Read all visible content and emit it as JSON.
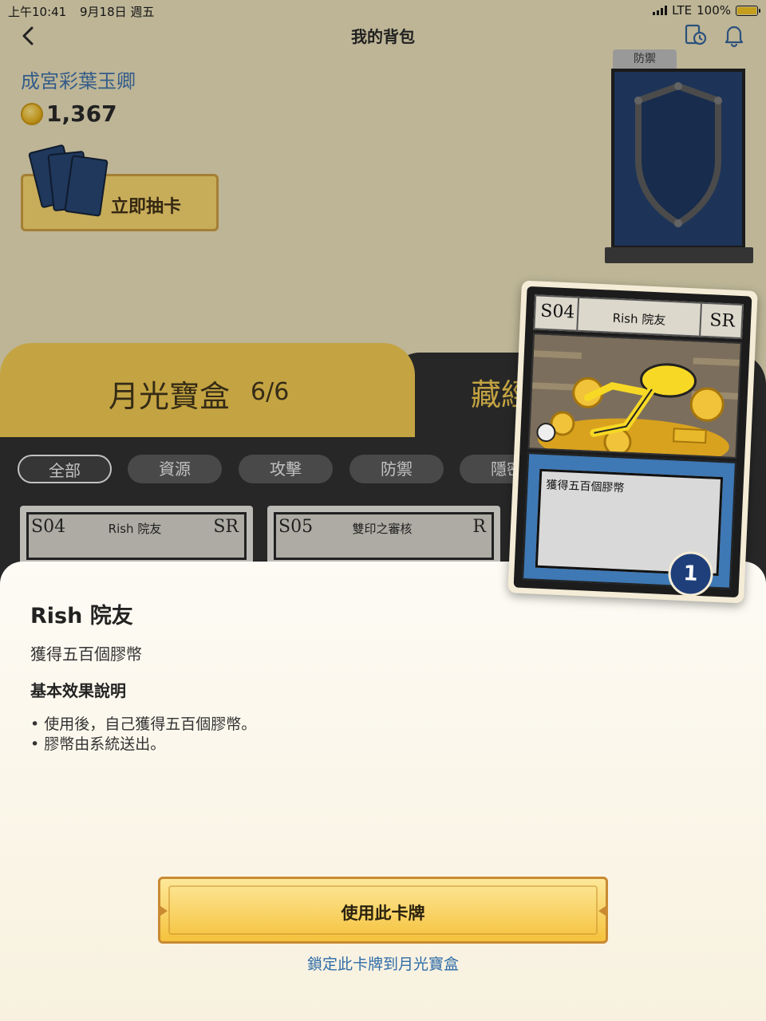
{
  "status_bar": {
    "time": "上午10:41",
    "date": "9月18日 週五",
    "network": "LTE",
    "battery": "100%"
  },
  "nav": {
    "title": "我的背包",
    "icons": [
      "chevron-left-icon",
      "card-history-icon",
      "bell-icon"
    ]
  },
  "profile": {
    "name": "成宮彩葉玉卿",
    "coins": "1,367"
  },
  "draw_button": {
    "label": "立即抽卡"
  },
  "defense_slot": {
    "label": "防禦"
  },
  "tabs": [
    {
      "label": "月光寶盒",
      "count": "6/6"
    },
    {
      "label": "藏經"
    }
  ],
  "filters": [
    "全部",
    "資源",
    "攻擊",
    "防禦",
    "隱密"
  ],
  "cards": [
    {
      "code": "S04",
      "name": "Rish 院友",
      "rarity": "SR"
    },
    {
      "code": "S05",
      "name": "雙印之審核",
      "rarity": "R"
    }
  ],
  "preview": {
    "code": "S04",
    "name": "Rish 院友",
    "rarity": "SR",
    "effect": "獲得五百個膠幣",
    "quantity": "1"
  },
  "detail": {
    "title": "Rish 院友",
    "description": "獲得五百個膠幣",
    "effect_heading": "基本效果說明",
    "effect_points": [
      "使用後，自己獲得五百個膠幣。",
      "膠幣由系統送出。"
    ],
    "use_button": "使用此卡牌",
    "lock_link": "鎖定此卡牌到月光寶盒"
  },
  "colors": {
    "accent_gold": "#f5c23c",
    "link_blue": "#2f6ca8",
    "card_blue": "#1f3f7a"
  }
}
